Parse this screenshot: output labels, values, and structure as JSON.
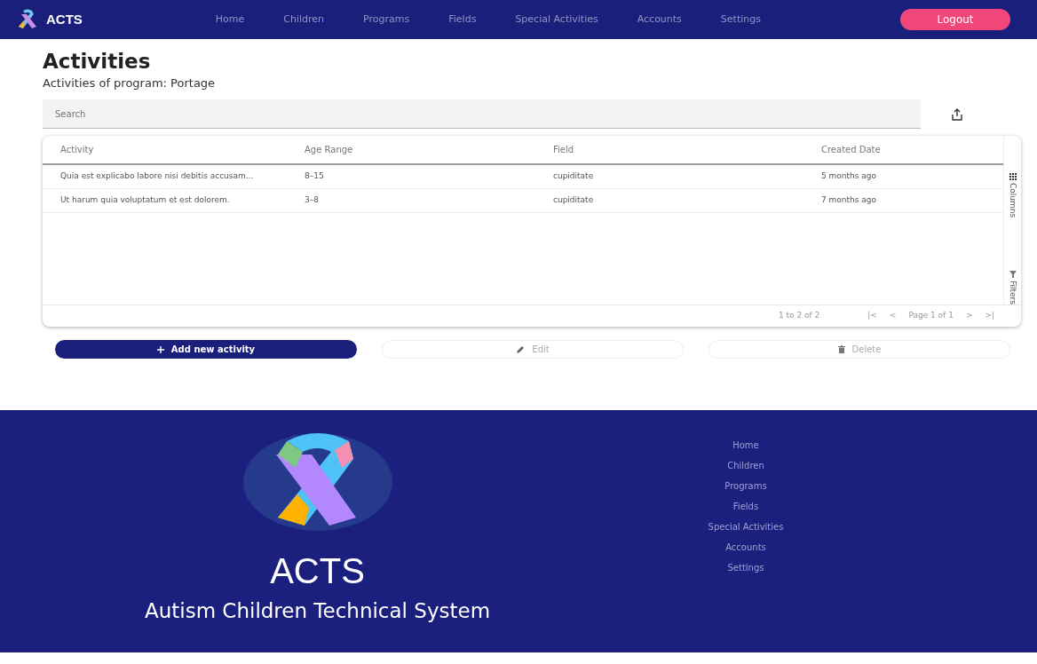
{
  "navbar": {
    "brand": "ACTS",
    "links": [
      {
        "label": "Home"
      },
      {
        "label": "Children"
      },
      {
        "label": "Programs"
      },
      {
        "label": "Fields"
      },
      {
        "label": "Special Activities"
      },
      {
        "label": "Accounts"
      },
      {
        "label": "Settings"
      }
    ],
    "logout": "Logout"
  },
  "page": {
    "title": "Activities",
    "subtitle": "Activities of program: Portage"
  },
  "search": {
    "placeholder": "Search"
  },
  "table": {
    "columns": [
      "Activity",
      "Age Range",
      "Field",
      "Created Date"
    ],
    "rows": [
      [
        "Quia est explicabo labore nisi debitis accusam...",
        "8–15",
        "cupiditate",
        "5 months ago"
      ],
      [
        "Ut harum quia voluptatum et est dolorem.",
        "3–8",
        "cupiditate",
        "7 months ago"
      ]
    ],
    "side_tabs": [
      {
        "label": "Columns",
        "kind": "columns"
      },
      {
        "label": "Filters",
        "kind": "filters"
      }
    ],
    "pagination": {
      "range": "1 to 2 of 2",
      "first": "|<",
      "prev": "<",
      "page": "Page 1 of 1",
      "next": ">",
      "last": ">|"
    }
  },
  "actions": [
    {
      "label": "Add new activity",
      "kind": "add",
      "disabled": false
    },
    {
      "label": "Edit",
      "kind": "edit",
      "disabled": true
    },
    {
      "label": "Delete",
      "kind": "delete",
      "disabled": true
    }
  ],
  "footer": {
    "title": "ACTS",
    "tagline": "Autism Children Technical System",
    "links": [
      {
        "label": "Home"
      },
      {
        "label": "Children"
      },
      {
        "label": "Programs"
      },
      {
        "label": "Fields"
      },
      {
        "label": "Special Activities"
      },
      {
        "label": "Accounts"
      },
      {
        "label": "Settings"
      }
    ]
  }
}
